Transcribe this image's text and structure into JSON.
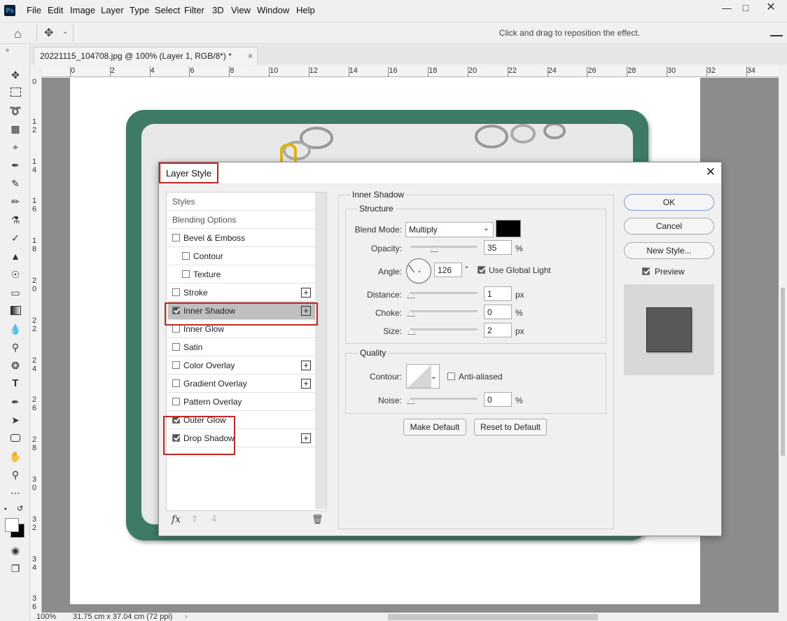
{
  "menu": {
    "logo": "Ps",
    "items": [
      "File",
      "Edit",
      "Image",
      "Layer",
      "Type",
      "Select",
      "Filter",
      "3D",
      "View",
      "Window",
      "Help"
    ]
  },
  "options_bar": {
    "hint": "Click and drag to reposition the effect."
  },
  "document_tab": {
    "title": "20221115_104708.jpg @ 100% (Layer 1, RGB/8*) *",
    "close": "×"
  },
  "ruler": {
    "h_ticks": [
      "0",
      "2",
      "4",
      "6",
      "8",
      "10",
      "12",
      "14",
      "16",
      "18",
      "20",
      "22",
      "24",
      "26",
      "28",
      "30",
      "32",
      "34"
    ],
    "v_ticks": [
      "0",
      "1\n2",
      "1\n4",
      "1\n6",
      "1\n8",
      "2\n0",
      "2\n2",
      "2\n4",
      "2\n6",
      "2\n8",
      "3\n0",
      "3\n2",
      "3\n4",
      "3\n6"
    ]
  },
  "status": {
    "zoom": "100%",
    "size": "31.75 cm x 37.04 cm (72 ppi)"
  },
  "dialog": {
    "title": "Layer Style",
    "styles": [
      {
        "label": "Styles",
        "checkbox": false,
        "checked": false,
        "plus": false,
        "indent": 0
      },
      {
        "label": "Blending Options",
        "checkbox": false,
        "checked": false,
        "plus": false,
        "indent": 0
      },
      {
        "label": "Bevel & Emboss",
        "checkbox": true,
        "checked": false,
        "plus": false,
        "indent": 0
      },
      {
        "label": "Contour",
        "checkbox": true,
        "checked": false,
        "plus": false,
        "indent": 1
      },
      {
        "label": "Texture",
        "checkbox": true,
        "checked": false,
        "plus": false,
        "indent": 1
      },
      {
        "label": "Stroke",
        "checkbox": true,
        "checked": false,
        "plus": true,
        "indent": 0
      },
      {
        "label": "Inner Shadow",
        "checkbox": true,
        "checked": true,
        "plus": true,
        "indent": 0,
        "selected": true
      },
      {
        "label": "Inner Glow",
        "checkbox": true,
        "checked": false,
        "plus": false,
        "indent": 0
      },
      {
        "label": "Satin",
        "checkbox": true,
        "checked": false,
        "plus": false,
        "indent": 0
      },
      {
        "label": "Color Overlay",
        "checkbox": true,
        "checked": false,
        "plus": true,
        "indent": 0
      },
      {
        "label": "Gradient Overlay",
        "checkbox": true,
        "checked": false,
        "plus": true,
        "indent": 0
      },
      {
        "label": "Pattern Overlay",
        "checkbox": true,
        "checked": false,
        "plus": false,
        "indent": 0
      },
      {
        "label": "Outer Glow",
        "checkbox": true,
        "checked": true,
        "plus": false,
        "indent": 0
      },
      {
        "label": "Drop Shadow",
        "checkbox": true,
        "checked": true,
        "plus": true,
        "indent": 0
      }
    ],
    "fx_label": "fx",
    "effect": {
      "section_title": "Inner Shadow",
      "structure_title": "Structure",
      "blend_mode_label": "Blend Mode:",
      "blend_mode_value": "Multiply",
      "shadow_color": "#000000",
      "opacity_label": "Opacity:",
      "opacity_value": "35",
      "opacity_unit": "%",
      "opacity_level": 0.35,
      "angle_label": "Angle:",
      "angle_value": "126",
      "angle_unit": "°",
      "global_light_label": "Use Global Light",
      "global_light_checked": true,
      "distance_label": "Distance:",
      "distance_value": "1",
      "distance_unit": "px",
      "choke_label": "Choke:",
      "choke_value": "0",
      "choke_unit": "%",
      "size_label": "Size:",
      "size_value": "2",
      "size_unit": "px",
      "quality_title": "Quality",
      "contour_label": "Contour:",
      "anti_aliased_label": "Anti-aliased",
      "noise_label": "Noise:",
      "noise_value": "0",
      "noise_unit": "%",
      "make_default": "Make Default",
      "reset_default": "Reset to Default"
    },
    "buttons": {
      "ok": "OK",
      "cancel": "Cancel",
      "new_style": "New Style...",
      "preview": "Preview",
      "preview_checked": true
    }
  },
  "colors": {
    "accent_red": "#c62828",
    "frame_green": "#3d7b66"
  }
}
